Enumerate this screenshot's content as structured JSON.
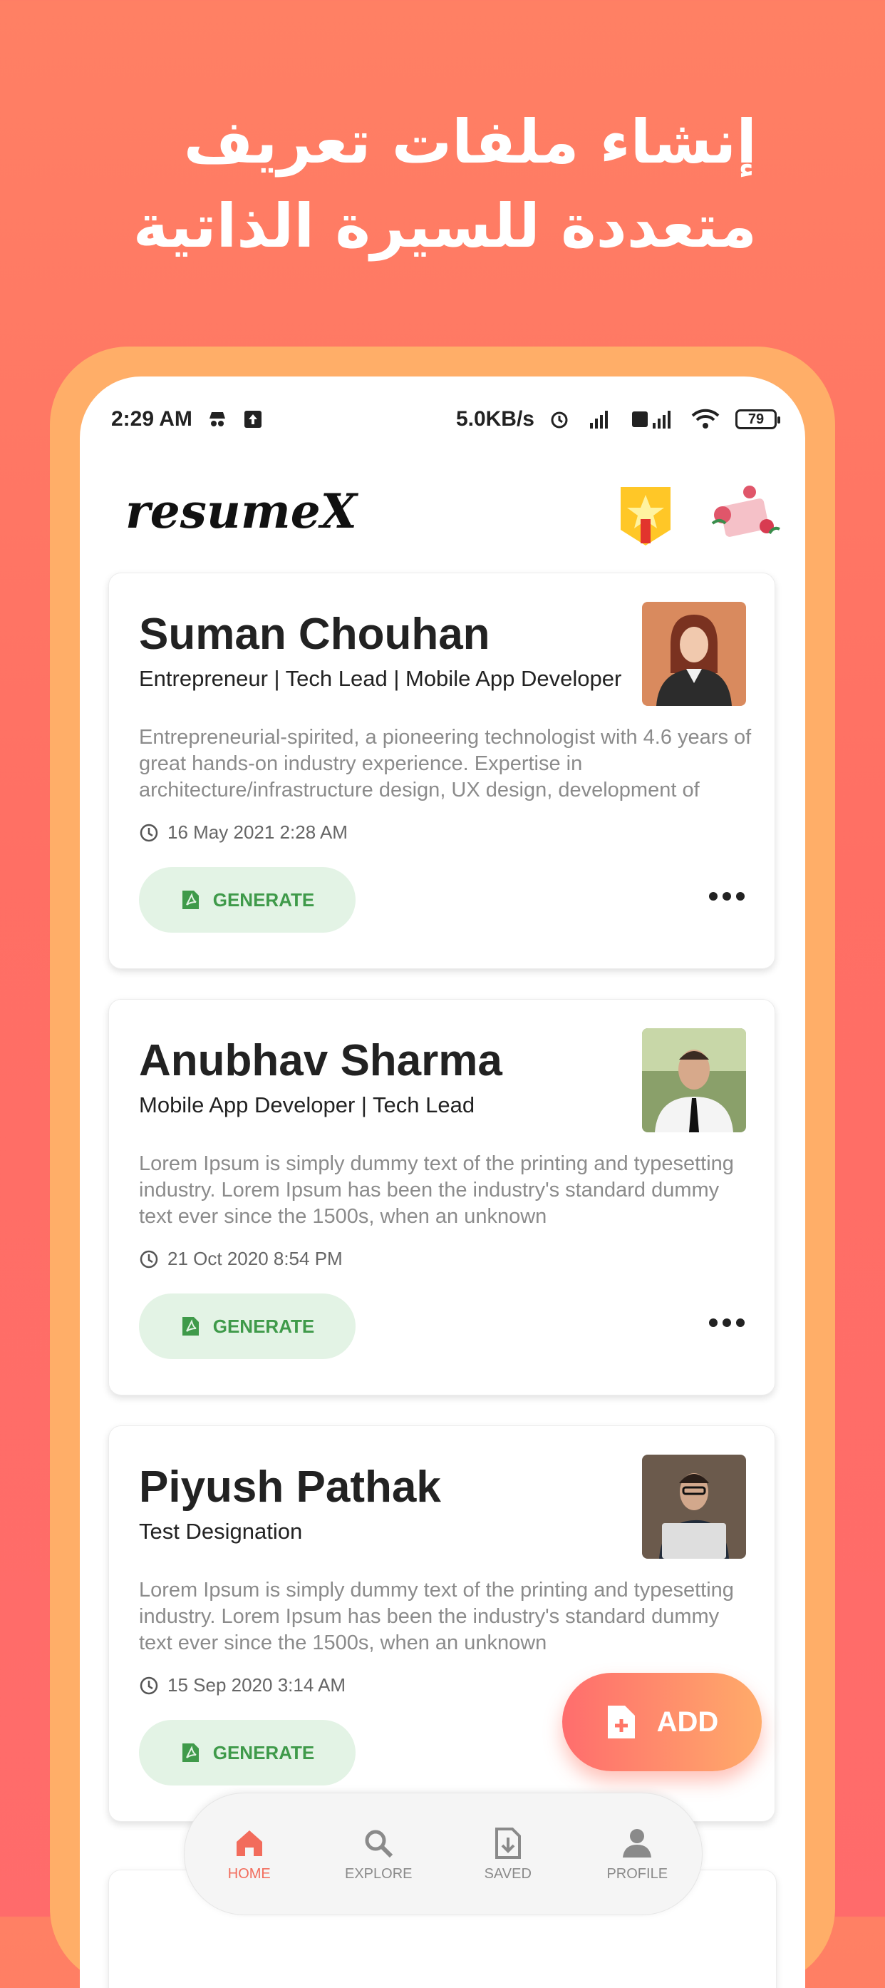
{
  "promo": {
    "headline": "إنشاء ملفات تعريف متعددة للسيرة الذاتية"
  },
  "status_bar": {
    "time": "2:29 AM",
    "net_speed": "5.0KB/s",
    "battery": "79"
  },
  "app": {
    "logo": "resumeX"
  },
  "resumes": [
    {
      "name": "Suman Chouhan",
      "title": "Entrepreneur | Tech Lead | Mobile App Developer",
      "summary": "Entrepreneurial-spirited, a pioneering technologist with 4.6 years of great hands-on industry experience. Expertise in architecture/infrastructure design, UX design, development of",
      "date": "16 May 2021 2:28 AM",
      "generate_label": "GENERATE"
    },
    {
      "name": "Anubhav Sharma",
      "title": "Mobile App Developer | Tech Lead",
      "summary": "Lorem Ipsum is simply dummy text of the printing and typesetting industry. Lorem Ipsum has been the industry's standard dummy text ever since the 1500s, when an unknown",
      "date": "21 Oct 2020 8:54 PM",
      "generate_label": "GENERATE"
    },
    {
      "name": "Piyush Pathak",
      "title": "Test Designation",
      "summary": "Lorem Ipsum is simply dummy text of the printing and typesetting industry. Lorem Ipsum has been the industry's standard dummy text ever since the 1500s, when an unknown",
      "date": "15 Sep 2020 3:14 AM",
      "generate_label": "GENERATE"
    }
  ],
  "fab": {
    "label": "ADD"
  },
  "bottom_nav": [
    {
      "label": "HOME",
      "icon": "home-icon",
      "active": true
    },
    {
      "label": "EXPLORE",
      "icon": "search-icon",
      "active": false
    },
    {
      "label": "SAVED",
      "icon": "download-icon",
      "active": false
    },
    {
      "label": "PROFILE",
      "icon": "person-icon",
      "active": false
    }
  ],
  "colors": {
    "background": "#ff7564",
    "frame": "#ffae68",
    "accent": "#f26c5c",
    "generate_bg": "#e3f3e5",
    "generate_text": "#3f9a4a"
  }
}
